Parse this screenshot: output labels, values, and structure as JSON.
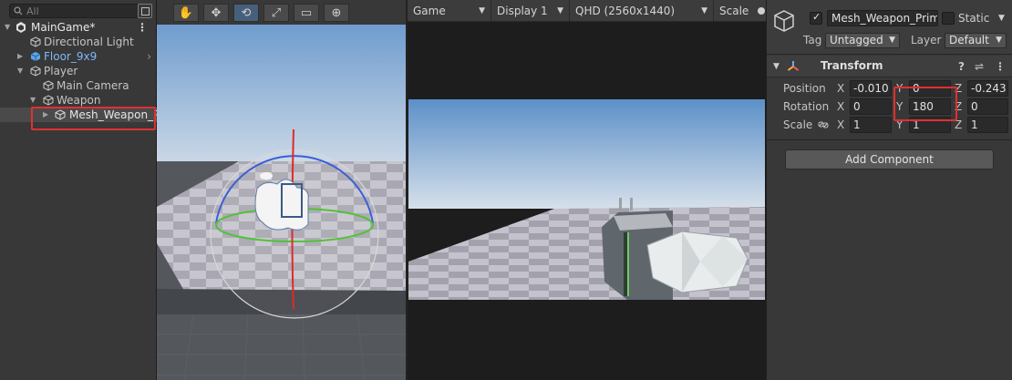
{
  "hierarchy": {
    "search_placeholder": "All",
    "items": [
      {
        "label": "MainGame*",
        "indent": 0
      },
      {
        "label": "Directional Light",
        "indent": 1
      },
      {
        "label": "Floor_9x9",
        "indent": 1
      },
      {
        "label": "Player",
        "indent": 1
      },
      {
        "label": "Main Camera",
        "indent": 2
      },
      {
        "label": "Weapon",
        "indent": 2
      },
      {
        "label": "Mesh_Weapon_P",
        "indent": 3
      }
    ]
  },
  "scene": {
    "tools": [
      "hand-tool",
      "move-tool",
      "rotate-tool",
      "scale-tool",
      "rect-tool",
      "transform-tool"
    ],
    "active_tool": "rotate-tool"
  },
  "game": {
    "tab_label": "Game",
    "display_label": "Display 1",
    "resolution_label": "QHD (2560x1440)",
    "scale_label": "Scale"
  },
  "inspector": {
    "object_name": "Mesh_Weapon_Prim",
    "static_label": "Static",
    "tag_label": "Tag",
    "tag_value": "Untagged",
    "layer_label": "Layer",
    "layer_value": "Default",
    "component_title": "Transform",
    "position_label": "Position",
    "rotation_label": "Rotation",
    "scale_label": "Scale",
    "position": {
      "x": "-0.010",
      "y": "0",
      "z": "-0.243"
    },
    "rotation": {
      "x": "0",
      "y": "180",
      "z": "0"
    },
    "scale": {
      "x": "1",
      "y": "1",
      "z": "1"
    },
    "add_component_label": "Add Component"
  },
  "colors": {
    "highlight": "#e03030",
    "prefab_blue": "#7cb9ff",
    "panel_bg": "#383838"
  }
}
